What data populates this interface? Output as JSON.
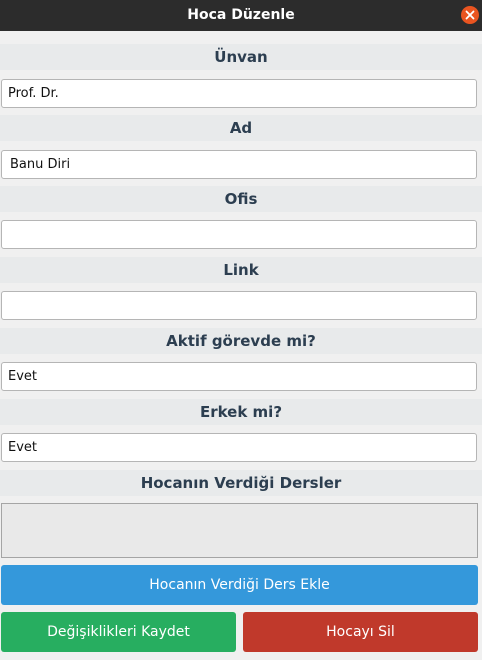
{
  "window": {
    "title": "Hoca Düzenle"
  },
  "fields": {
    "unvan": {
      "label": "Ünvan",
      "value": "Prof. Dr."
    },
    "ad": {
      "label": "Ad",
      "value": "Banu Diri"
    },
    "ofis": {
      "label": "Ofis",
      "value": ""
    },
    "link": {
      "label": "Link",
      "value": ""
    },
    "aktif": {
      "label": "Aktif görevde mi?",
      "value": "Evet"
    },
    "erkek": {
      "label": "Erkek mi?",
      "value": "Evet"
    }
  },
  "courses": {
    "label": "Hocanın Verdiği Dersler",
    "items": []
  },
  "buttons": {
    "add_course": "Hocanın Verdiği Ders Ekle",
    "save": "Değişiklikleri Kaydet",
    "delete": "Hocayı Sil"
  },
  "colors": {
    "titlebar": "#2c2c2c",
    "close": "#e95420",
    "label_text": "#2c3e50",
    "add_button": "#3498db",
    "save_button": "#27ae60",
    "delete_button": "#c0392b"
  },
  "icons": {
    "close": "close-icon"
  }
}
